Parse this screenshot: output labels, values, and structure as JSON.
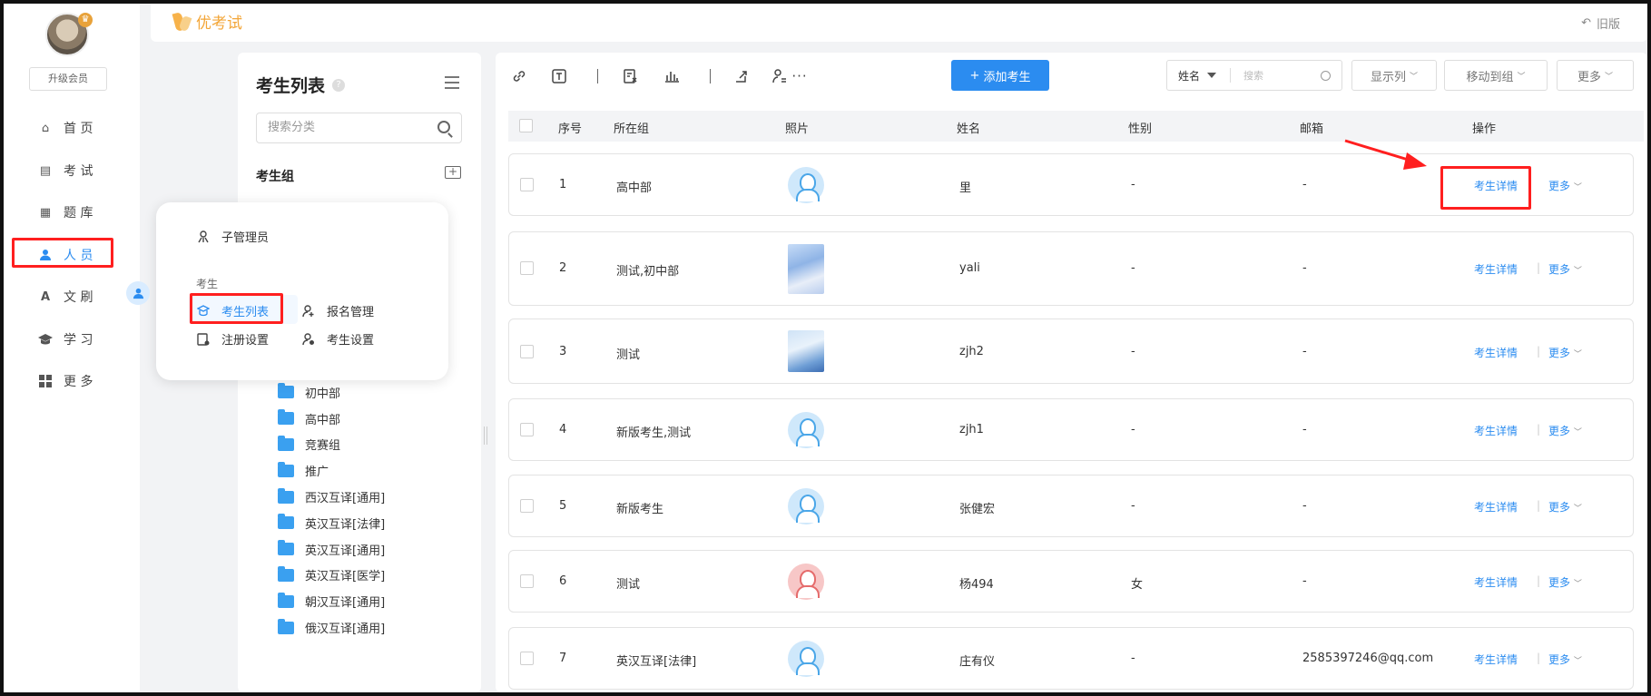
{
  "leftnav": {
    "upgrade_label": "升级会员",
    "items": [
      {
        "label": "首 页",
        "icon": "home-icon"
      },
      {
        "label": "考 试",
        "icon": "exam-icon"
      },
      {
        "label": "题 库",
        "icon": "question-bank-icon"
      },
      {
        "label": "人 员",
        "icon": "person-icon",
        "active": true
      },
      {
        "label": "文 刷",
        "icon": "text-icon"
      },
      {
        "label": "学 习",
        "icon": "graduation-cap-icon"
      },
      {
        "label": "更 多",
        "icon": "grid-icon"
      }
    ]
  },
  "topbar": {
    "logo_text": "优考试",
    "old_version_label": "旧版"
  },
  "category": {
    "title": "考生列表",
    "help_mark": "?",
    "search_placeholder": "搜索分类",
    "group_header": "考生组",
    "folders": [
      "初中部",
      "高中部",
      "竞赛组",
      "推广",
      "西汉互译[通用]",
      "英汉互译[法律]",
      "英汉互译[通用]",
      "英汉互译[医学]",
      "朝汉互译[通用]",
      "俄汉互译[通用]"
    ]
  },
  "popup": {
    "sub_admin_label": "子管理员",
    "section_label": "考生",
    "items": [
      {
        "label": "考生列表",
        "active": true
      },
      {
        "label": "报名管理"
      },
      {
        "label": "注册设置"
      },
      {
        "label": "考生设置"
      }
    ]
  },
  "toolbar": {
    "add_button_label": "添加考生",
    "add_button_plus": "+",
    "more_dots": "···",
    "search_field_select": "姓名",
    "search_placeholder": "搜索",
    "display_columns_label": "显示列",
    "move_to_group_label": "移动到组",
    "more_label": "更多"
  },
  "table": {
    "headers": {
      "index": "序号",
      "group": "所在组",
      "photo": "照片",
      "name": "姓名",
      "gender": "性别",
      "email": "邮箱",
      "actions": "操作"
    },
    "detail_label": "考生详情",
    "more_label": "更多",
    "action_separator": "|",
    "rows": [
      {
        "index": "1",
        "group": "高中部",
        "photo": "default-avatar",
        "name": "里",
        "gender": "-",
        "email": "-"
      },
      {
        "index": "2",
        "group": "测试,初中部",
        "photo": "anime-photo",
        "name": "yali",
        "gender": "-",
        "email": "-"
      },
      {
        "index": "3",
        "group": "测试",
        "photo": "anime-photo",
        "name": "zjh2",
        "gender": "-",
        "email": "-"
      },
      {
        "index": "4",
        "group": "新版考生,测试",
        "photo": "default-avatar",
        "name": "zjh1",
        "gender": "-",
        "email": "-"
      },
      {
        "index": "5",
        "group": "新版考生",
        "photo": "default-avatar",
        "name": "张健宏",
        "gender": "-",
        "email": "-"
      },
      {
        "index": "6",
        "group": "测试",
        "photo": "female-avatar",
        "name": "杨494",
        "gender": "女",
        "email": "-"
      },
      {
        "index": "7",
        "group": "英汉互译[法律]",
        "photo": "default-avatar",
        "name": "庄有仪",
        "gender": "-",
        "email": "2585397246@qq.com"
      }
    ]
  },
  "colors": {
    "accent": "#2b8cf0",
    "annotation_red": "#ff1f1f",
    "logo_orange": "#f3a638"
  }
}
